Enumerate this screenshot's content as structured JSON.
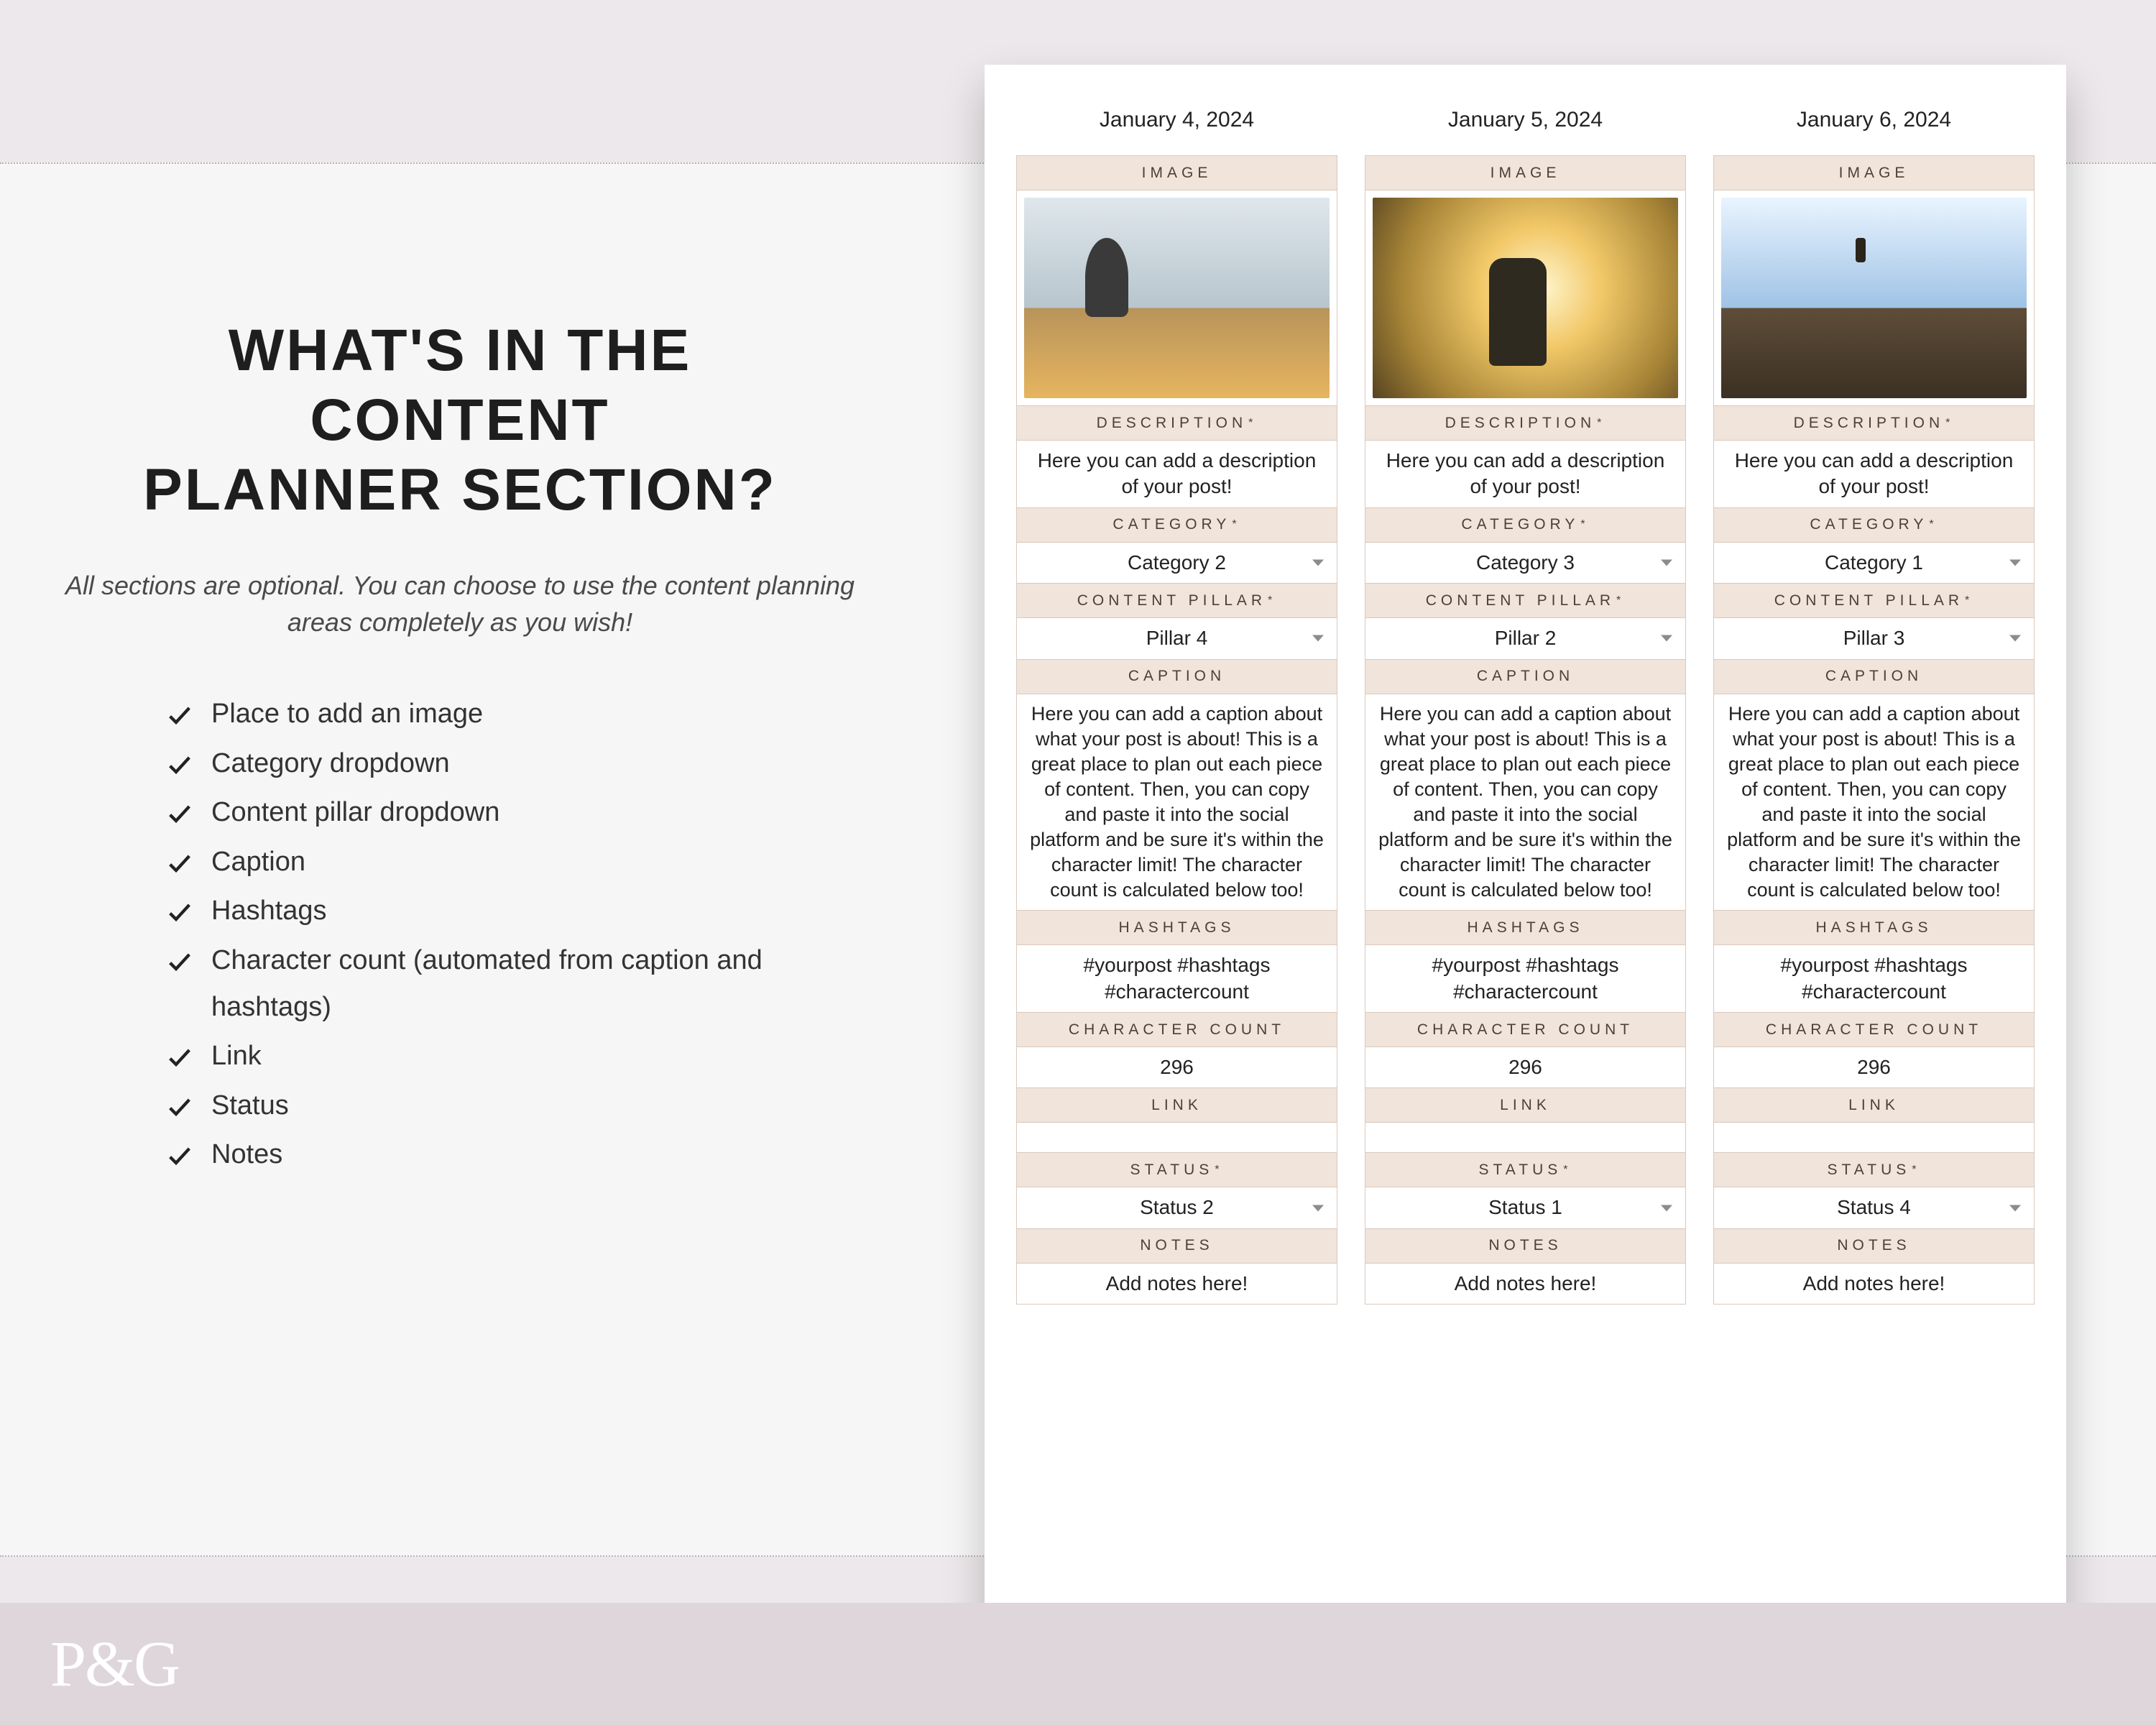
{
  "logo": "P&G",
  "left": {
    "heading_l1": "WHAT'S IN THE",
    "heading_l2": "CONTENT",
    "heading_l3": "PLANNER SECTION?",
    "sub": "All sections are optional. You can choose to use the content planning areas completely as you wish!",
    "items": [
      "Place to add an image",
      "Category dropdown",
      "Content pillar dropdown",
      "Caption",
      "Hashtags",
      "Character count (automated from caption and hashtags)",
      "Link",
      "Status",
      "Notes"
    ]
  },
  "labels": {
    "image": "IMAGE",
    "description": "DESCRIPTION",
    "category": "CATEGORY",
    "pillar": "CONTENT PILLAR",
    "caption": "CAPTION",
    "hashtags": "HASHTAGS",
    "charcount": "CHARACTER COUNT",
    "link": "LINK",
    "status": "STATUS",
    "notes": "NOTES",
    "star": "*"
  },
  "shared": {
    "description": "Here you can add a description of your post!",
    "caption": "Here you can add a caption about what your post is about! This is a great place to plan out each piece of content. Then, you can copy and paste it into the social platform and be sure it's within the character limit! The character count is calculated below too!",
    "hashtags": "#yourpost #hashtags #charactercount",
    "charcount": "296",
    "link": "",
    "notes": "Add notes here!"
  },
  "cols": [
    {
      "date": "January 4, 2024",
      "category": "Category 2",
      "pillar": "Pillar 4",
      "status": "Status 2",
      "photo": "ph1"
    },
    {
      "date": "January 5, 2024",
      "category": "Category 3",
      "pillar": "Pillar 2",
      "status": "Status 1",
      "photo": "ph2"
    },
    {
      "date": "January 6, 2024",
      "category": "Category 1",
      "pillar": "Pillar 3",
      "status": "Status 4",
      "photo": "ph3"
    }
  ]
}
